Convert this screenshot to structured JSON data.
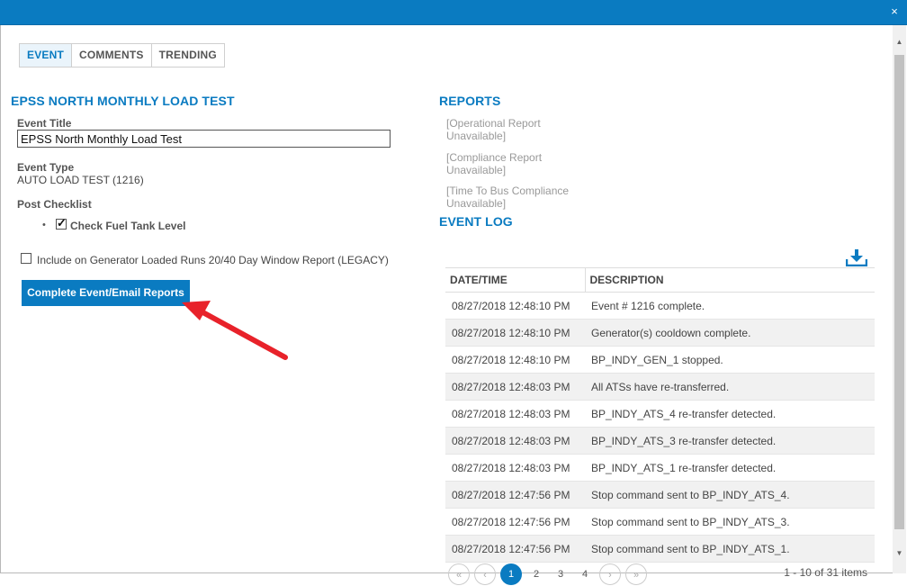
{
  "window": {
    "close_glyph": "×"
  },
  "tabs": [
    {
      "label": "EVENT",
      "active": true
    },
    {
      "label": "COMMENTS",
      "active": false
    },
    {
      "label": "TRENDING",
      "active": false
    }
  ],
  "event": {
    "heading": "EPSS NORTH MONTHLY LOAD TEST",
    "title_label": "Event Title",
    "title_value": "EPSS North Monthly Load Test",
    "type_label": "Event Type",
    "type_value": "AUTO LOAD TEST (1216)",
    "checklist_label": "Post Checklist",
    "checklist_item": "Check Fuel Tank Level",
    "checklist_checked": true,
    "include_label": "Include on Generator Loaded Runs 20/40 Day Window Report (LEGACY)",
    "include_checked": false,
    "complete_button": "Complete Event/Email Reports"
  },
  "reports": {
    "heading": "REPORTS",
    "items": [
      "[Operational Report Unavailable]",
      "[Compliance Report Unavailable]",
      "[Time To Bus Compliance Unavailable]"
    ]
  },
  "event_log": {
    "heading": "EVENT LOG",
    "columns": [
      "DATE/TIME",
      "DESCRIPTION"
    ],
    "rows": [
      [
        "08/27/2018 12:48:10 PM",
        "Event # 1216 complete."
      ],
      [
        "08/27/2018 12:48:10 PM",
        "Generator(s) cooldown complete."
      ],
      [
        "08/27/2018 12:48:10 PM",
        "BP_INDY_GEN_1 stopped."
      ],
      [
        "08/27/2018 12:48:03 PM",
        "All ATSs have re-transferred."
      ],
      [
        "08/27/2018 12:48:03 PM",
        "BP_INDY_ATS_4 re-transfer detected."
      ],
      [
        "08/27/2018 12:48:03 PM",
        "BP_INDY_ATS_3 re-transfer detected."
      ],
      [
        "08/27/2018 12:48:03 PM",
        "BP_INDY_ATS_1 re-transfer detected."
      ],
      [
        "08/27/2018 12:47:56 PM",
        "Stop command sent to BP_INDY_ATS_4."
      ],
      [
        "08/27/2018 12:47:56 PM",
        "Stop command sent to BP_INDY_ATS_3."
      ],
      [
        "08/27/2018 12:47:56 PM",
        "Stop command sent to BP_INDY_ATS_1."
      ]
    ],
    "pager": {
      "pages": [
        "1",
        "2",
        "3",
        "4"
      ],
      "current": "1",
      "info": "1 - 10 of 31 items"
    }
  },
  "colors": {
    "accent": "#0a7bc1",
    "annotation_arrow": "#e8222a"
  }
}
